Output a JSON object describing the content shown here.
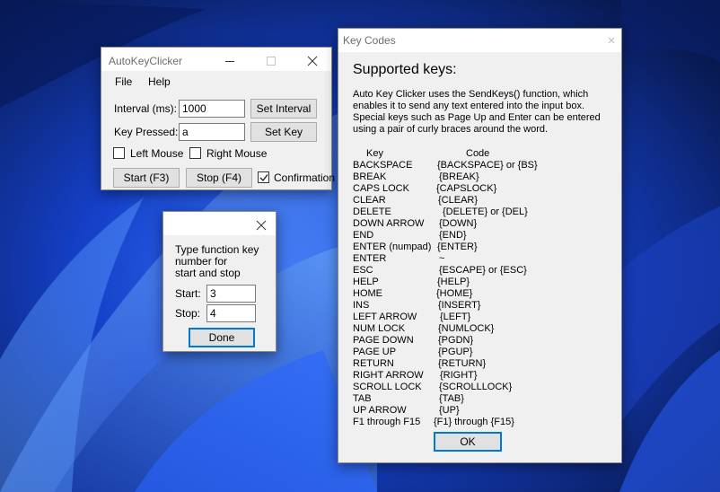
{
  "main_window": {
    "title": "AutoKeyClicker",
    "menu": [
      "File",
      "Help"
    ],
    "interval_label": "Interval (ms):",
    "interval_value": "1000",
    "set_interval_label": "Set Interval",
    "key_label": "Key Pressed:",
    "key_value": "a",
    "set_key_label": "Set Key",
    "left_mouse_label": "Left Mouse",
    "right_mouse_label": "Right Mouse",
    "start_label": "Start (F3)",
    "stop_label": "Stop (F4)",
    "confirmation_label": "Confirmation",
    "confirmation_checked": true
  },
  "function_dialog": {
    "prompt": [
      "Type function key",
      "number for",
      "start and stop"
    ],
    "start_label": "Start:",
    "start_value": "3",
    "stop_label": "Stop:",
    "stop_value": "4",
    "done_label": "Done"
  },
  "key_codes_window": {
    "title": "Key Codes",
    "heading": "Supported keys:",
    "description": "Auto Key Clicker uses the SendKeys() function, which enables it to send any text entered into the input box. Special keys such as Page Up and Enter can be entered using a pair of curly braces around the word.",
    "col_key": "Key",
    "col_code": "Code",
    "rows": [
      {
        "key": "BACKSPACE",
        "code": "{BACKSPACE} or {BS}"
      },
      {
        "key": "BREAK",
        "code": "{BREAK}"
      },
      {
        "key": "CAPS LOCK",
        "code": "{CAPSLOCK}"
      },
      {
        "key": "CLEAR",
        "code": "{CLEAR}"
      },
      {
        "key": "DELETE",
        "code": "{DELETE} or {DEL}"
      },
      {
        "key": "DOWN ARROW",
        "code": "{DOWN}"
      },
      {
        "key": "END",
        "code": "{END}"
      },
      {
        "key": "ENTER (numpad)",
        "code": "{ENTER}"
      },
      {
        "key": "ENTER",
        "code": "~"
      },
      {
        "key": "ESC",
        "code": "{ESCAPE} or {ESC}"
      },
      {
        "key": "HELP",
        "code": "{HELP}"
      },
      {
        "key": "HOME",
        "code": "{HOME}"
      },
      {
        "key": "INS",
        "code": "{INSERT}"
      },
      {
        "key": "LEFT ARROW",
        "code": "{LEFT}"
      },
      {
        "key": "NUM LOCK",
        "code": "{NUMLOCK}"
      },
      {
        "key": "PAGE DOWN",
        "code": "{PGDN}"
      },
      {
        "key": "PAGE UP",
        "code": "{PGUP}"
      },
      {
        "key": "RETURN",
        "code": "{RETURN}"
      },
      {
        "key": "RIGHT ARROW",
        "code": "{RIGHT}"
      },
      {
        "key": "SCROLL LOCK",
        "code": "{SCROLLLOCK}"
      },
      {
        "key": "TAB",
        "code": "{TAB}"
      },
      {
        "key": "UP ARROW",
        "code": "{UP}"
      },
      {
        "key": "F1 through F15",
        "code": "{F1} through {F15}"
      }
    ],
    "ok_label": "OK"
  },
  "colors": {
    "accent": "#0078d7",
    "window_bg": "#f0f0f0",
    "wallpaper_dark": "#06103a",
    "wallpaper_bloom": "#1e5bff"
  }
}
